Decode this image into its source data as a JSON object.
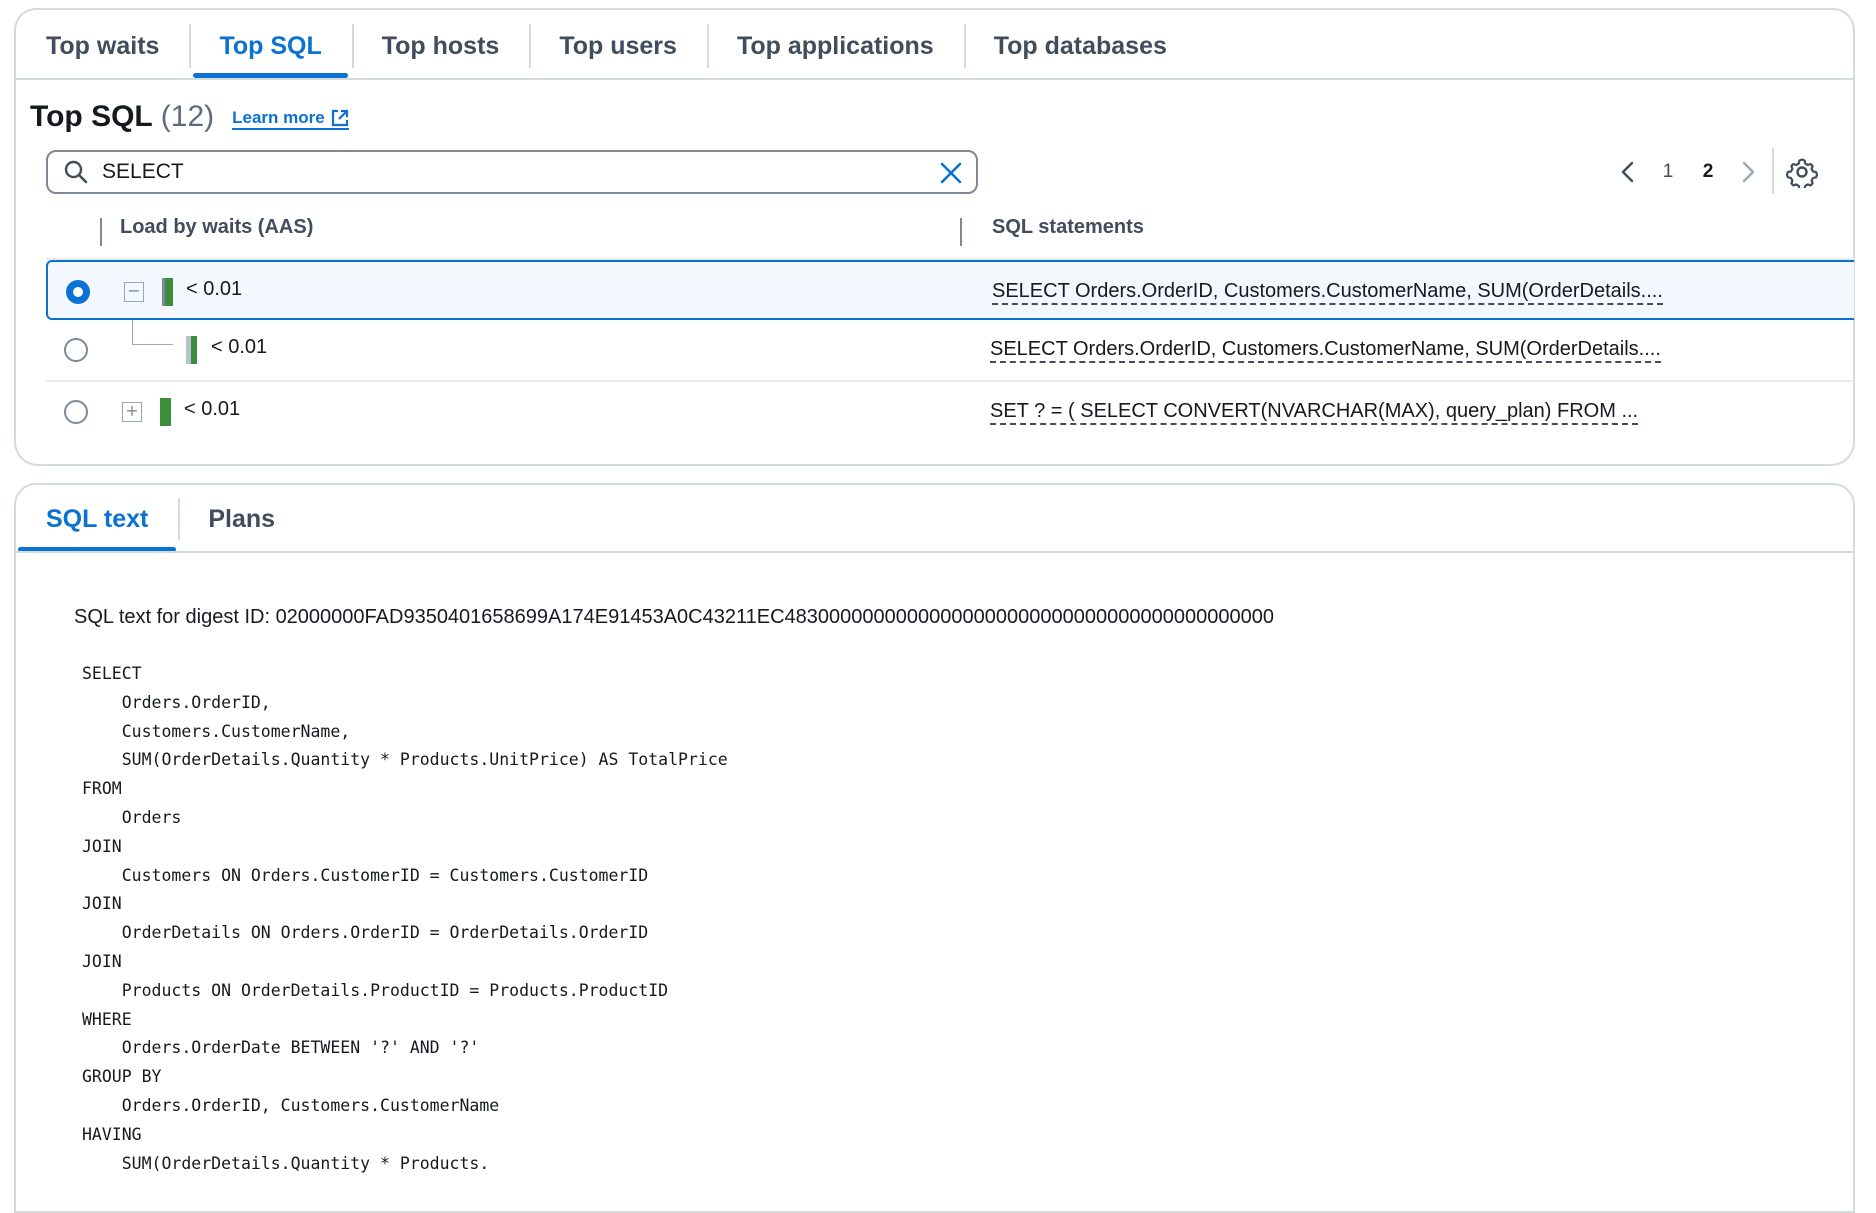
{
  "top_tabs": [
    {
      "label": "Top waits"
    },
    {
      "label": "Top SQL"
    },
    {
      "label": "Top hosts"
    },
    {
      "label": "Top users"
    },
    {
      "label": "Top applications"
    },
    {
      "label": "Top databases"
    }
  ],
  "active_top_tab": "Top SQL",
  "header": {
    "title": "Top SQL",
    "count": "(12)",
    "learn_more": "Learn more"
  },
  "search": {
    "value": "SELECT"
  },
  "pagination": {
    "pages": [
      "1",
      "2"
    ],
    "current": "2"
  },
  "table": {
    "columns": [
      "Load by waits (AAS)",
      "SQL statements"
    ],
    "rows": [
      {
        "load": "< 0.01",
        "sql": "SELECT Orders.OrderID, Customers.CustomerName, SUM(OrderDetails....",
        "selected": true,
        "expander": "collapse"
      },
      {
        "load": "< 0.01",
        "sql": "SELECT Orders.OrderID, Customers.CustomerName, SUM(OrderDetails....",
        "selected": false,
        "expander": "child"
      },
      {
        "load": "< 0.01",
        "sql": "SET ? = ( SELECT CONVERT(NVARCHAR(MAX), query_plan) FROM ...",
        "selected": false,
        "expander": "expand"
      }
    ]
  },
  "colors": {
    "accent": "#0972d3",
    "load_bar_green": "#3b8f3a",
    "load_bar_gray": "#7d8998"
  },
  "bottom_tabs": [
    {
      "label": "SQL text"
    },
    {
      "label": "Plans"
    }
  ],
  "active_bottom_tab": "SQL text",
  "sql_text": {
    "digest_line": "SQL text for digest ID: 02000000FAD9350401658699A174E91453A0C43211EC48300000000000000000000000000000000000000000",
    "code": "SELECT\n    Orders.OrderID,\n    Customers.CustomerName,\n    SUM(OrderDetails.Quantity * Products.UnitPrice) AS TotalPrice\nFROM\n    Orders\nJOIN\n    Customers ON Orders.CustomerID = Customers.CustomerID\nJOIN\n    OrderDetails ON Orders.OrderID = OrderDetails.OrderID\nJOIN\n    Products ON OrderDetails.ProductID = Products.ProductID\nWHERE\n    Orders.OrderDate BETWEEN '?' AND '?'\nGROUP BY\n    Orders.OrderID, Customers.CustomerName\nHAVING\n    SUM(OrderDetails.Quantity * Products."
  }
}
